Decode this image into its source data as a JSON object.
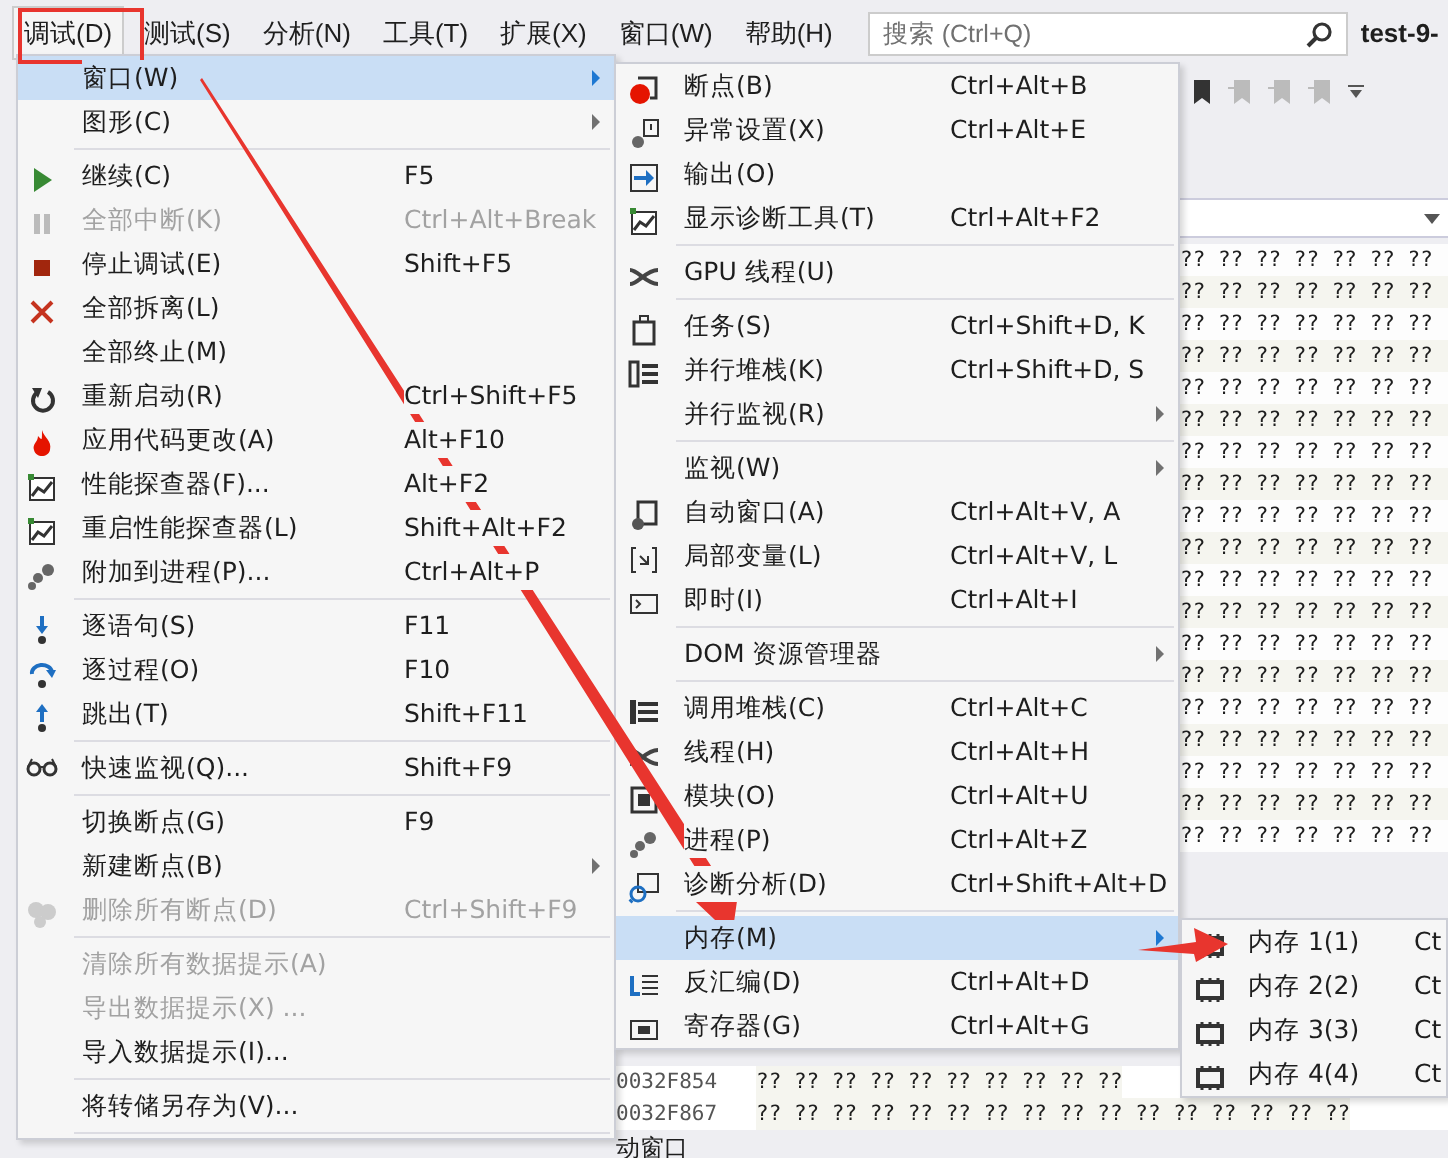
{
  "menu_bar": {
    "items": [
      {
        "label": "调试(D)",
        "selected": true
      },
      {
        "label": "测试(S)",
        "selected": false
      },
      {
        "label": "分析(N)",
        "selected": false
      },
      {
        "label": "工具(T)",
        "selected": false
      },
      {
        "label": "扩展(X)",
        "selected": false
      },
      {
        "label": "窗口(W)",
        "selected": false
      },
      {
        "label": "帮助(H)",
        "selected": false
      }
    ],
    "search": {
      "placeholder": "搜索 (Ctrl+Q)"
    },
    "document_tab": "test-9-"
  },
  "memory_window": {
    "right_rows": [
      "?? ?? ?? ?? ?? ?? ??",
      "?? ?? ?? ?? ?? ?? ??",
      "?? ?? ?? ?? ?? ?? ??",
      "?? ?? ?? ?? ?? ?? ??",
      "?? ?? ?? ?? ?? ?? ??",
      "?? ?? ?? ?? ?? ?? ??",
      "?? ?? ?? ?? ?? ?? ??",
      "?? ?? ?? ?? ?? ?? ??",
      "?? ?? ?? ?? ?? ?? ??",
      "?? ?? ?? ?? ?? ?? ??",
      "?? ?? ?? ?? ?? ?? ??",
      "?? ?? ?? ?? ?? ?? ??",
      "?? ?? ?? ?? ?? ?? ??",
      "?? ?? ?? ?? ?? ?? ??",
      "?? ?? ?? ?? ?? ?? ??",
      "?? ?? ?? ?? ?? ?? ??",
      "?? ?? ?? ?? ?? ?? ??",
      "?? ?? ?? ?? ?? ?? ??",
      "?? ?? ?? ?? ?? ?? ??"
    ],
    "rows": [
      {
        "address": "0032F854",
        "bytes": "?? ?? ?? ?? ?? ?? ?? ?? ?? ??"
      },
      {
        "address": "0032F867",
        "bytes": "?? ?? ?? ?? ?? ?? ?? ?? ?? ?? ?? ?? ?? ?? ?? ??"
      }
    ],
    "bottom_tab": "动窗口"
  },
  "debug_menu": {
    "items": [
      {
        "kind": "item",
        "label": "窗口(W)",
        "submenu": true,
        "disabled": false,
        "selected": true
      },
      {
        "kind": "item",
        "label": "图形(C)",
        "submenu": true,
        "disabled": false,
        "selected": false
      },
      {
        "kind": "separator"
      },
      {
        "kind": "item",
        "label": "继续(C)",
        "shortcut": "F5",
        "submenu": false,
        "disabled": false,
        "selected": false
      },
      {
        "kind": "item",
        "label": "全部中断(K)",
        "shortcut": "Ctrl+Alt+Break",
        "submenu": false,
        "disabled": true,
        "selected": false
      },
      {
        "kind": "item",
        "label": "停止调试(E)",
        "shortcut": "Shift+F5",
        "submenu": false,
        "disabled": false,
        "selected": false
      },
      {
        "kind": "item",
        "label": "全部拆离(L)",
        "submenu": false,
        "disabled": false,
        "selected": false
      },
      {
        "kind": "item",
        "label": "全部终止(M)",
        "submenu": false,
        "disabled": false,
        "selected": false
      },
      {
        "kind": "item",
        "label": "重新启动(R)",
        "shortcut": "Ctrl+Shift+F5",
        "submenu": false,
        "disabled": false,
        "selected": false
      },
      {
        "kind": "item",
        "label": "应用代码更改(A)",
        "shortcut": "Alt+F10",
        "submenu": false,
        "disabled": false,
        "selected": false
      },
      {
        "kind": "item",
        "label": "性能探查器(F)...",
        "shortcut": "Alt+F2",
        "submenu": false,
        "disabled": false,
        "selected": false
      },
      {
        "kind": "item",
        "label": "重启性能探查器(L)",
        "shortcut": "Shift+Alt+F2",
        "submenu": false,
        "disabled": false,
        "selected": false
      },
      {
        "kind": "item",
        "label": "附加到进程(P)...",
        "shortcut": "Ctrl+Alt+P",
        "submenu": false,
        "disabled": false,
        "selected": false
      },
      {
        "kind": "separator"
      },
      {
        "kind": "item",
        "label": "逐语句(S)",
        "shortcut": "F11",
        "submenu": false,
        "disabled": false,
        "selected": false
      },
      {
        "kind": "item",
        "label": "逐过程(O)",
        "shortcut": "F10",
        "submenu": false,
        "disabled": false,
        "selected": false
      },
      {
        "kind": "item",
        "label": "跳出(T)",
        "shortcut": "Shift+F11",
        "submenu": false,
        "disabled": false,
        "selected": false
      },
      {
        "kind": "separator"
      },
      {
        "kind": "item",
        "label": "快速监视(Q)...",
        "shortcut": "Shift+F9",
        "submenu": false,
        "disabled": false,
        "selected": false
      },
      {
        "kind": "separator"
      },
      {
        "kind": "item",
        "label": "切换断点(G)",
        "shortcut": "F9",
        "submenu": false,
        "disabled": false,
        "selected": false
      },
      {
        "kind": "item",
        "label": "新建断点(B)",
        "submenu": true,
        "disabled": false,
        "selected": false
      },
      {
        "kind": "item",
        "label": "删除所有断点(D)",
        "shortcut": "Ctrl+Shift+F9",
        "submenu": false,
        "disabled": true,
        "selected": false
      },
      {
        "kind": "separator"
      },
      {
        "kind": "item",
        "label": "清除所有数据提示(A)",
        "submenu": false,
        "disabled": true,
        "selected": false
      },
      {
        "kind": "item",
        "label": "导出数据提示(X) ...",
        "submenu": false,
        "disabled": true,
        "selected": false
      },
      {
        "kind": "item",
        "label": "导入数据提示(I)...",
        "submenu": false,
        "disabled": false,
        "selected": false
      },
      {
        "kind": "separator"
      },
      {
        "kind": "item",
        "label": "将转储另存为(V)...",
        "submenu": false,
        "disabled": false,
        "selected": false
      },
      {
        "kind": "separator"
      }
    ]
  },
  "window_submenu": {
    "items": [
      {
        "kind": "item",
        "label": "断点(B)",
        "shortcut": "Ctrl+Alt+B",
        "submenu": false,
        "selected": false
      },
      {
        "kind": "item",
        "label": "异常设置(X)",
        "shortcut": "Ctrl+Alt+E",
        "submenu": false,
        "selected": false
      },
      {
        "kind": "item",
        "label": "输出(O)",
        "submenu": false,
        "selected": false
      },
      {
        "kind": "item",
        "label": "显示诊断工具(T)",
        "shortcut": "Ctrl+Alt+F2",
        "submenu": false,
        "selected": false
      },
      {
        "kind": "separator"
      },
      {
        "kind": "item",
        "label": "GPU 线程(U)",
        "submenu": false,
        "selected": false
      },
      {
        "kind": "separator"
      },
      {
        "kind": "item",
        "label": "任务(S)",
        "shortcut": "Ctrl+Shift+D, K",
        "submenu": false,
        "selected": false
      },
      {
        "kind": "item",
        "label": "并行堆栈(K)",
        "shortcut": "Ctrl+Shift+D, S",
        "submenu": false,
        "selected": false
      },
      {
        "kind": "item",
        "label": "并行监视(R)",
        "submenu": true,
        "selected": false
      },
      {
        "kind": "separator"
      },
      {
        "kind": "item",
        "label": "监视(W)",
        "submenu": true,
        "selected": false
      },
      {
        "kind": "item",
        "label": "自动窗口(A)",
        "shortcut": "Ctrl+Alt+V, A",
        "submenu": false,
        "selected": false
      },
      {
        "kind": "item",
        "label": "局部变量(L)",
        "shortcut": "Ctrl+Alt+V, L",
        "submenu": false,
        "selected": false
      },
      {
        "kind": "item",
        "label": "即时(I)",
        "shortcut": "Ctrl+Alt+I",
        "submenu": false,
        "selected": false
      },
      {
        "kind": "separator"
      },
      {
        "kind": "item",
        "label": "DOM 资源管理器",
        "submenu": true,
        "selected": false
      },
      {
        "kind": "separator"
      },
      {
        "kind": "item",
        "label": "调用堆栈(C)",
        "shortcut": "Ctrl+Alt+C",
        "submenu": false,
        "selected": false
      },
      {
        "kind": "item",
        "label": "线程(H)",
        "shortcut": "Ctrl+Alt+H",
        "submenu": false,
        "selected": false
      },
      {
        "kind": "item",
        "label": "模块(O)",
        "shortcut": "Ctrl+Alt+U",
        "submenu": false,
        "selected": false
      },
      {
        "kind": "item",
        "label": "进程(P)",
        "shortcut": "Ctrl+Alt+Z",
        "submenu": false,
        "selected": false
      },
      {
        "kind": "item",
        "label": "诊断分析(D)",
        "shortcut": "Ctrl+Shift+Alt+D",
        "submenu": false,
        "selected": false
      },
      {
        "kind": "separator"
      },
      {
        "kind": "item",
        "label": "内存(M)",
        "submenu": true,
        "selected": true
      },
      {
        "kind": "item",
        "label": "反汇编(D)",
        "shortcut": "Ctrl+Alt+D",
        "submenu": false,
        "selected": false
      },
      {
        "kind": "item",
        "label": "寄存器(G)",
        "shortcut": "Ctrl+Alt+G",
        "submenu": false,
        "selected": false
      }
    ]
  },
  "memory_submenu": {
    "items": [
      {
        "label": "内存 1(1)",
        "shortcut": "Ct",
        "selected": false
      },
      {
        "label": "内存 2(2)",
        "shortcut": "Ct",
        "selected": false
      },
      {
        "label": "内存 3(3)",
        "shortcut": "Ct",
        "selected": false
      },
      {
        "label": "内存 4(4)",
        "shortcut": "Ct",
        "selected": false
      }
    ]
  }
}
